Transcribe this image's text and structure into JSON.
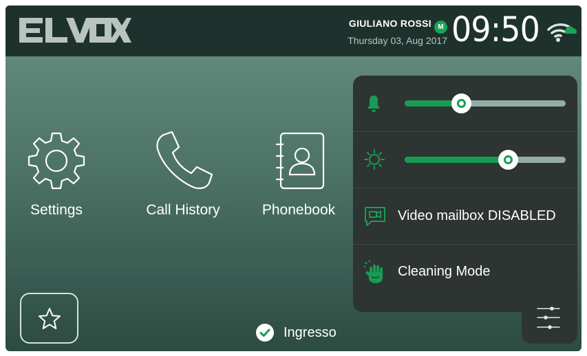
{
  "brand": {
    "logo_text": "ELVOX"
  },
  "header": {
    "user_name": "GIULIANO ROSSI",
    "user_badge": "M",
    "date": "Thursday 03, Aug 2017",
    "time": "09:50",
    "connection_icon": "wifi-cloud-icon"
  },
  "apps": [
    {
      "label": "Settings",
      "icon": "gear-icon"
    },
    {
      "label": "Call History",
      "icon": "phone-icon"
    },
    {
      "label": "Phonebook",
      "icon": "address-book-icon"
    }
  ],
  "favorites": {
    "icon": "star-icon"
  },
  "status": {
    "label": "Ingresso",
    "icon": "check-circle-icon"
  },
  "quick_panel": {
    "ringtone_volume": {
      "icon": "bell-icon",
      "level_percent": 35
    },
    "brightness": {
      "icon": "sun-icon",
      "level_percent": 64
    },
    "video_mailbox": {
      "label": "Video mailbox DISABLED",
      "icon": "video-message-icon"
    },
    "cleaning_mode": {
      "label": "Cleaning Mode",
      "icon": "cleaning-hand-icon"
    },
    "toggle_icon": "sliders-icon"
  },
  "colors": {
    "accent": "#189c54",
    "topbar": "#1e322d",
    "panel": "#2d3432",
    "background_top": "#6b8f84",
    "background_bottom": "#2c4b42"
  }
}
